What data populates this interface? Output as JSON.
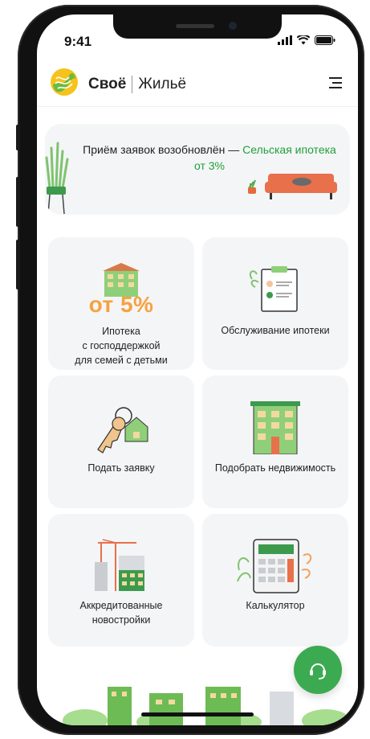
{
  "status_bar": {
    "time": "9:41"
  },
  "header": {
    "brand_bold": "Своё",
    "brand_light": "Жильё"
  },
  "banner": {
    "text": "Приём заявок возобновлён — ",
    "link": "Сельская ипотека от 3%"
  },
  "tiles": [
    {
      "promo": "от 5%",
      "label_lines": [
        "Ипотека",
        "с господдержкой",
        "для семей с детьми"
      ]
    },
    {
      "label_lines": [
        "Обслуживание ипотеки"
      ]
    },
    {
      "label_lines": [
        "Подать заявку"
      ]
    },
    {
      "label_lines": [
        "Подобрать недвижимость"
      ]
    },
    {
      "label_lines": [
        "Аккредитованные",
        "новостройки"
      ]
    },
    {
      "label_lines": [
        "Калькулятор"
      ]
    }
  ],
  "colors": {
    "accent_green": "#21a038",
    "promo_orange": "#f7a23e",
    "tile_bg": "#f4f5f7",
    "fab_green": "#3caa50"
  },
  "icons": [
    "signal-icon",
    "wifi-icon",
    "battery-icon",
    "menu-icon",
    "support-headset-icon"
  ]
}
